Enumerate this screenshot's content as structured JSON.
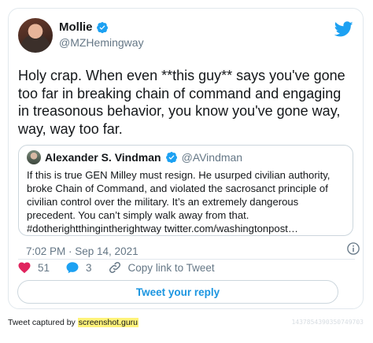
{
  "tweet": {
    "author_name": "Mollie",
    "author_handle": "@MZHemingway",
    "text": "Holy crap. When even **this guy** says you've gone too far in breaking chain of command and engaging in treasonous behavior, you know you've gone way, way, way too far.",
    "timestamp": "7:02 PM · Sep 14, 2021",
    "likes": "51",
    "replies": "3",
    "copy_link_label": "Copy link to Tweet",
    "reply_button_label": "Tweet your reply"
  },
  "quoted": {
    "author_name": "Alexander S. Vindman",
    "author_handle": "@AVindman",
    "text": "If this is true GEN Milley must resign. He usurped civilian authority, broke Chain of Command, and violated the sacrosanct principle of civilian control over the military. It’s an extremely dangerous precedent. You can’t simply walk away from that. #dotherightthingintherightway twitter.com/washingtonpost…"
  },
  "footer": {
    "prefix": "Tweet captured by ",
    "brand": "screenshot.guru",
    "tweet_id": "1437854390350749703"
  },
  "colors": {
    "brand_blue": "#1da1f2",
    "link_blue": "#1b95e0",
    "like_red": "#e0245e",
    "muted": "#657786"
  },
  "icons": {
    "verified": "verified-badge-icon",
    "bird": "twitter-bird-icon",
    "info": "info-icon",
    "like": "heart-icon",
    "reply": "reply-bubble-icon",
    "link": "link-icon"
  }
}
